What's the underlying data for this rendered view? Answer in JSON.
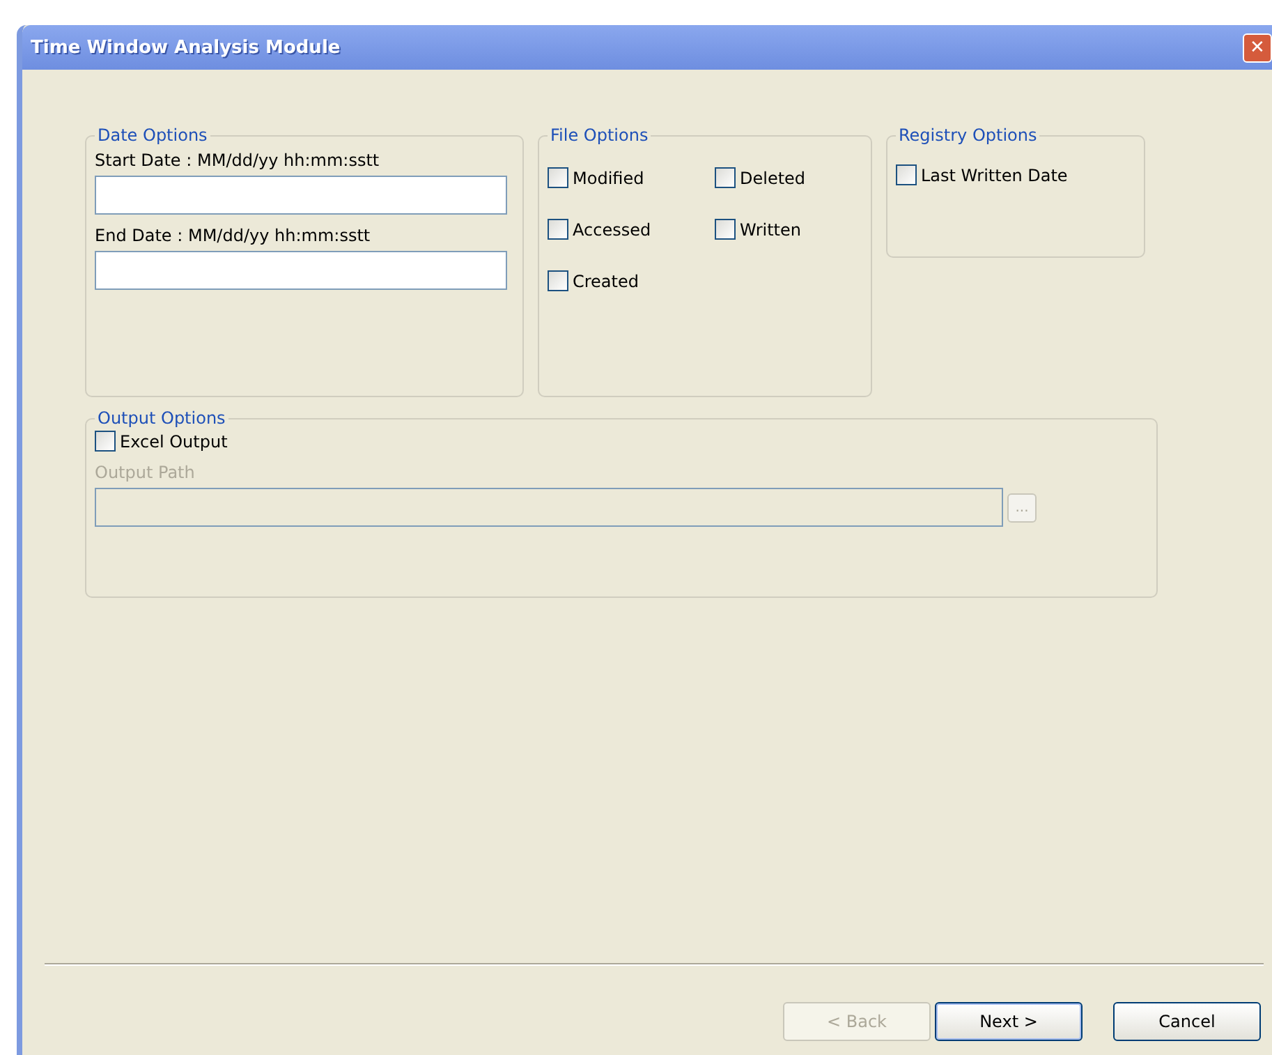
{
  "window": {
    "title": "Time Window Analysis Module",
    "close": "✕"
  },
  "date_options": {
    "title": "Date Options",
    "fields": [
      {
        "label": "Start Date : MM/dd/yy hh:mm:sstt"
      },
      {
        "label": "End Date : MM/dd/yy hh:mm:sstt"
      }
    ]
  },
  "file_options": {
    "title": "File Options",
    "checkboxes": [
      {
        "label": "Modified",
        "checked": false
      },
      {
        "label": "Deleted",
        "checked": false
      },
      {
        "label": "Accessed",
        "checked": false
      },
      {
        "label": "Written",
        "checked": false
      },
      {
        "label": "Created",
        "checked": false
      }
    ]
  },
  "registry_options": {
    "title": "Registry Options",
    "checkboxes": [
      {
        "label": "Last Written Date",
        "checked": false
      }
    ]
  },
  "output_options": {
    "title": "Output Options",
    "excel": {
      "label": "Excel Output",
      "checked": false
    },
    "path": {
      "label": "Output Path",
      "disabled": true
    },
    "browse": {
      "label": "...",
      "disabled": true
    }
  },
  "buttons": [
    {
      "label": "< Back",
      "disabled": true,
      "default": false
    },
    {
      "label": "Next >",
      "disabled": false,
      "default": true
    },
    {
      "label": "Cancel",
      "disabled": false,
      "default": false
    }
  ]
}
